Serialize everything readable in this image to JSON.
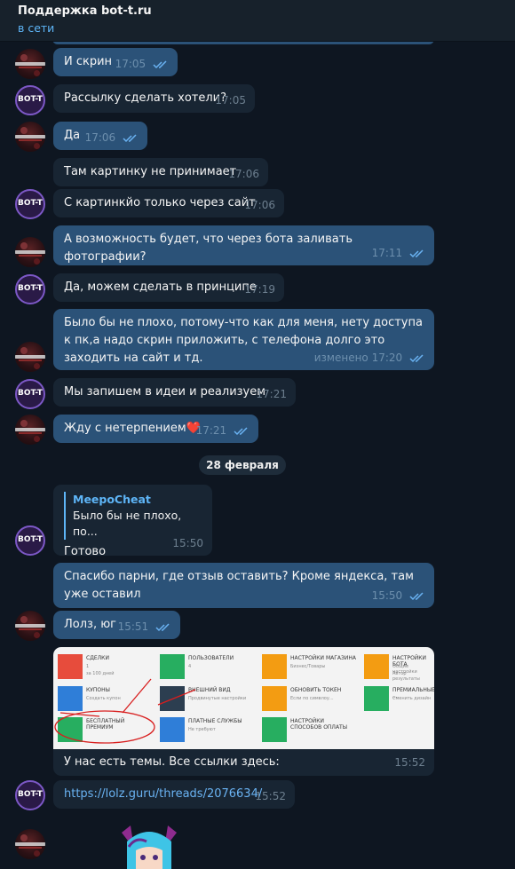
{
  "header": {
    "title": "Поддержка bot-t.ru",
    "status": "в сети"
  },
  "avatars": {
    "bot_label": "BOT-T"
  },
  "messages": [
    {
      "text": "И скрин",
      "time": "17:05"
    },
    {
      "text": "Рассылку сделать хотели?",
      "time": "17:05"
    },
    {
      "text": "Да",
      "time": "17:06"
    },
    {
      "text": "Там картинку не принимает",
      "time": "17:06"
    },
    {
      "text": "С картинкйо только через сайт",
      "time": "17:06"
    },
    {
      "text": "А возможность будет, что через бота заливать фотографии?",
      "time": "17:11"
    },
    {
      "text": "Да, можем сделать в принципе",
      "time": "17:19"
    },
    {
      "text": "Было бы не плохо, потому-что как для меня, нету доступа к пк,а надо скрин приложить, с телефона долго это заходить на сайт и тд.",
      "time": "изменено 17:20"
    },
    {
      "text": "Мы запишем в идеи и реализуем",
      "time": "17:21"
    },
    {
      "text": "Жду с нетерпением❤️",
      "time": "17:21"
    },
    {
      "quote_name": "MeepoCheat",
      "quote_text": "Было бы не плохо, по...",
      "text": "Готово",
      "time": "15:50"
    },
    {
      "text": "Спасибо парни, где отзыв оставить? Кроме яндекса, там уже оставил",
      "time": "15:50"
    },
    {
      "text": "Лолз, юг",
      "time": "15:51"
    },
    {
      "text": "У нас есть темы. Все ссылки здесь:",
      "time": "15:52"
    },
    {
      "text": "https://lolz.guru/threads/2076634/",
      "time": "15:52"
    }
  ],
  "date_separator": "28 февраля",
  "screenshot_tiles": [
    {
      "title": "СДЕЛКИ",
      "sub": "1",
      "sub2": "за 100 дней",
      "color": "#e74c3c"
    },
    {
      "title": "ПОЛЬЗОВАТЕЛИ",
      "sub": "4",
      "sub2": "",
      "color": "#27ae60"
    },
    {
      "title": "НАСТРОЙКИ МАГАЗИНА",
      "sub": "Бизнес/Товары",
      "sub2": "",
      "color": "#f39c12"
    },
    {
      "title": "НАСТРОЙКИ БОТА",
      "sub": "Общие настройки",
      "sub2": "Автор результаты",
      "color": "#f39c12"
    },
    {
      "title": "КУПОНЫ",
      "sub": "Создать купон",
      "sub2": "",
      "color": "#2f7ed8"
    },
    {
      "title": "ВНЕШНИЙ ВИД",
      "sub": "Продвинутые настройки",
      "sub2": "",
      "color": "#2c3e50"
    },
    {
      "title": "ОБНОВИТЬ ТОКЕН",
      "sub": "Если по симвлоу...",
      "sub2": "",
      "color": "#f39c12"
    },
    {
      "title": "ПРЕМИАЛЬНЫЕ ...",
      "sub": "Сменить дизайн",
      "sub2": "",
      "color": "#27ae60"
    },
    {
      "title": "БЕСПЛАТНЫЙ ПРЕМИУМ",
      "sub": "",
      "sub2": "",
      "color": "#27ae60"
    },
    {
      "title": "ПЛАТНЫЕ СЛУЖБЫ",
      "sub": "Не требуют",
      "sub2": "",
      "color": "#2f7ed8"
    },
    {
      "title": "НАСТРОЙКИ СПОСОБОВ ОПЛАТЫ",
      "sub": "",
      "sub2": "",
      "color": "#27ae60"
    }
  ],
  "colors": {
    "outgoing": "#2b5278",
    "incoming": "#182533",
    "accent": "#5eb5f7",
    "background": "#0e1621"
  }
}
